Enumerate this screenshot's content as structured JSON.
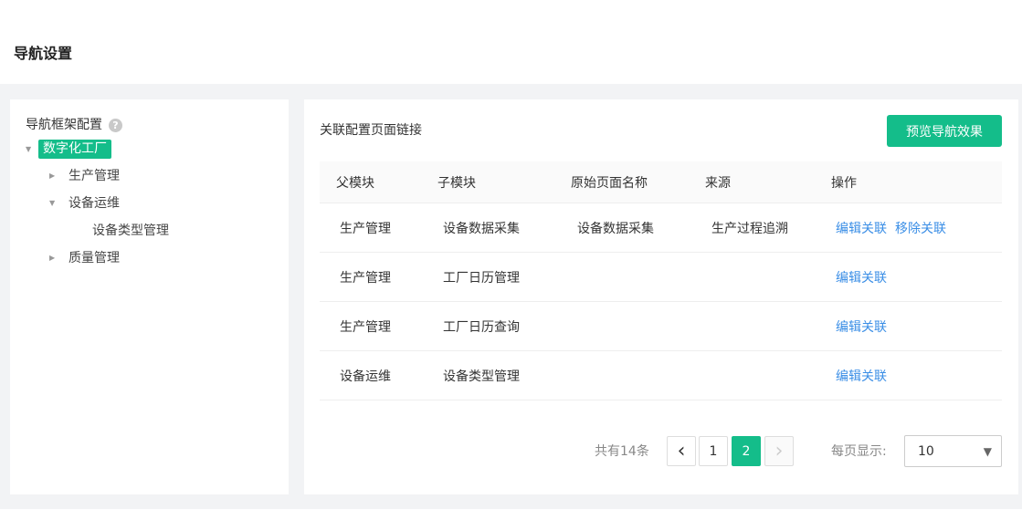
{
  "page": {
    "title": "导航设置"
  },
  "tree": {
    "title": "导航框架配置",
    "help_icon": "?",
    "root": {
      "label": "数字化工厂",
      "caret": "▼"
    },
    "nodes": [
      {
        "label": "生产管理",
        "caret": "▶"
      },
      {
        "label": "设备运维",
        "caret": "▼"
      },
      {
        "label": "设备类型管理",
        "caret": ""
      },
      {
        "label": "质量管理",
        "caret": "▶"
      }
    ]
  },
  "main": {
    "section_title": "关联配置页面链接",
    "preview_button": "预览导航效果",
    "table": {
      "headers": [
        "父模块",
        "子模块",
        "原始页面名称",
        "来源",
        "操作"
      ],
      "rows": [
        {
          "parent": "生产管理",
          "child": "设备数据采集",
          "original": "设备数据采集",
          "source": "生产过程追溯",
          "actions": [
            "编辑关联",
            "移除关联"
          ]
        },
        {
          "parent": "生产管理",
          "child": "工厂日历管理",
          "original": "",
          "source": "",
          "actions": [
            "编辑关联"
          ]
        },
        {
          "parent": "生产管理",
          "child": "工厂日历查询",
          "original": "",
          "source": "",
          "actions": [
            "编辑关联"
          ]
        },
        {
          "parent": "设备运维",
          "child": "设备类型管理",
          "original": "",
          "source": "",
          "actions": [
            "编辑关联"
          ]
        }
      ]
    },
    "pagination": {
      "total_text": "共有14条",
      "prev_icon": "‹",
      "next_icon": "›",
      "pages": [
        "1",
        "2"
      ],
      "current_page": "2",
      "per_page_label": "每页显示:",
      "per_page_value": "10",
      "select_arrow": "▼"
    }
  },
  "colors": {
    "accent": "#14bd8a",
    "link": "#3a8ee6"
  }
}
